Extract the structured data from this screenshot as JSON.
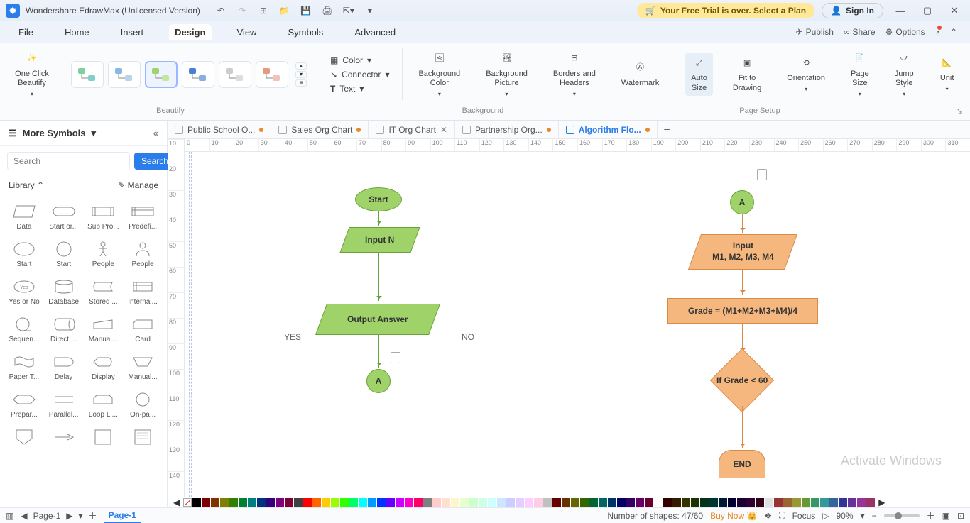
{
  "titlebar": {
    "app_name": "Wondershare EdrawMax (Unlicensed Version)",
    "trial_text": "Your Free Trial is over. Select a Plan",
    "signin": "Sign In"
  },
  "menu": {
    "items": [
      "File",
      "Home",
      "Insert",
      "Design",
      "View",
      "Symbols",
      "Advanced"
    ],
    "active": "Design",
    "publish": "Publish",
    "share": "Share",
    "options": "Options"
  },
  "ribbon": {
    "one_click": "One Click\nBeautify",
    "color": "Color",
    "connector": "Connector",
    "text": "Text",
    "bg_color": "Background\nColor",
    "bg_pic": "Background\nPicture",
    "borders": "Borders and\nHeaders",
    "watermark": "Watermark",
    "auto_size": "Auto\nSize",
    "fit": "Fit to\nDrawing",
    "orientation": "Orientation",
    "page_size": "Page\nSize",
    "jump_style": "Jump\nStyle",
    "unit": "Unit",
    "group_beautify": "Beautify",
    "group_background": "Background",
    "group_pagesetup": "Page Setup"
  },
  "sidebar": {
    "more_symbols": "More Symbols",
    "search_placeholder": "Search",
    "search_btn": "Search",
    "library": "Library",
    "manage": "Manage",
    "shapes": [
      [
        "Data",
        "Start or...",
        "Sub Pro...",
        "Predefi..."
      ],
      [
        "Start",
        "Start",
        "People",
        "People"
      ],
      [
        "Yes or No",
        "Database",
        "Stored ...",
        "Internal..."
      ],
      [
        "Sequen...",
        "Direct ...",
        "Manual...",
        "Card"
      ],
      [
        "Paper T...",
        "Delay",
        "Display",
        "Manual..."
      ],
      [
        "Prepar...",
        "Parallel...",
        "Loop Li...",
        "On-pa..."
      ]
    ]
  },
  "tabs": {
    "items": [
      {
        "label": "Public School O...",
        "modified": true,
        "close": false
      },
      {
        "label": "Sales Org Chart",
        "modified": true,
        "close": false
      },
      {
        "label": "IT Org Chart",
        "modified": false,
        "close": true
      },
      {
        "label": "Partnership Org...",
        "modified": true,
        "close": false
      },
      {
        "label": "Algorithm Flo...",
        "modified": true,
        "close": false,
        "active": true
      }
    ]
  },
  "canvas": {
    "flowchart_left": {
      "start": "Start",
      "inputN": "Input N",
      "output": "Output Answer",
      "connA": "A",
      "yes": "YES",
      "no": "NO"
    },
    "flowchart_right": {
      "connA": "A",
      "input": "Input\nM1, M2, M3, M4",
      "grade": "Grade = (M1+M2+M3+M4)/4",
      "decision": "If Grade < 60",
      "end": "END"
    },
    "watermark": "Activate Windows"
  },
  "ruler_h": [
    "0",
    "10",
    "20",
    "30",
    "40",
    "50",
    "60",
    "70",
    "80",
    "90",
    "100",
    "110",
    "120",
    "130",
    "140",
    "150",
    "160",
    "170",
    "180",
    "190",
    "200",
    "210",
    "220",
    "230",
    "240",
    "250",
    "260",
    "270",
    "280",
    "290",
    "300",
    "310"
  ],
  "ruler_v": [
    "10",
    "20",
    "30",
    "40",
    "50",
    "60",
    "70",
    "80",
    "90",
    "100",
    "110",
    "120",
    "130",
    "140"
  ],
  "status": {
    "page": "Page-1",
    "page_tab": "Page-1",
    "shapes": "Number of shapes: 47/60",
    "buy": "Buy Now",
    "focus": "Focus",
    "zoom": "90%"
  },
  "colors": [
    "#000000",
    "#7f0000",
    "#7f3300",
    "#7f7f00",
    "#337f00",
    "#007f33",
    "#007f7f",
    "#00337f",
    "#33007f",
    "#7f007f",
    "#7f0033",
    "#404040",
    "#ff0000",
    "#ff6600",
    "#ffcc00",
    "#99ff00",
    "#33ff00",
    "#00ff66",
    "#00ffff",
    "#0099ff",
    "#0033ff",
    "#6600ff",
    "#cc00ff",
    "#ff00cc",
    "#ff0066",
    "#808080",
    "#ffcccc",
    "#ffe0cc",
    "#fff5cc",
    "#e6ffcc",
    "#ccffcc",
    "#ccffe6",
    "#ccffff",
    "#cce6ff",
    "#ccccff",
    "#e6ccff",
    "#ffccff",
    "#ffcce6",
    "#c0c0c0",
    "#660000",
    "#663300",
    "#666600",
    "#336600",
    "#006633",
    "#006666",
    "#003366",
    "#000066",
    "#330066",
    "#660066",
    "#660033",
    "#ffffff",
    "#330000",
    "#331a00",
    "#333300",
    "#1a3300",
    "#00331a",
    "#003333",
    "#001a33",
    "#000033",
    "#1a0033",
    "#330033",
    "#33001a",
    "#e0e0e0",
    "#993333",
    "#996633",
    "#999933",
    "#669933",
    "#339966",
    "#339999",
    "#336699",
    "#333399",
    "#663399",
    "#993399",
    "#993366"
  ]
}
